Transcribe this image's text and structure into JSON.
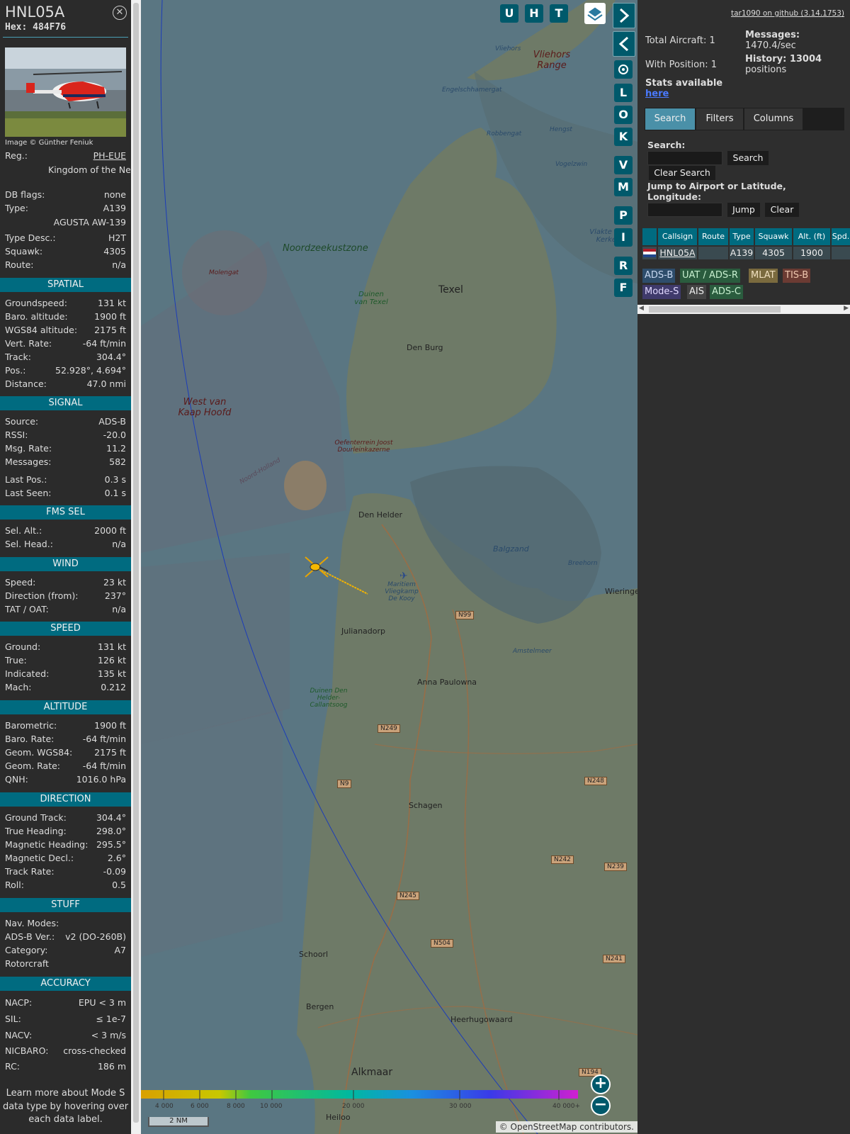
{
  "aircraft": {
    "callsign": "HNL05A",
    "hex": "Hex: 484F76",
    "image_credit": "Image © Günther Feniuk",
    "basic": [
      {
        "label": "Reg.:",
        "value": "PH-EUE"
      },
      {
        "label": "",
        "value": "Kingdom of the Netherlands"
      },
      {
        "label": "DB flags:",
        "value": "none"
      },
      {
        "label": "Type:",
        "value": "A139"
      },
      {
        "label": "",
        "value": "AGUSTA AW-139"
      },
      {
        "label": "Type Desc.:",
        "value": "H2T"
      },
      {
        "label": "Squawk:",
        "value": "4305"
      },
      {
        "label": "Route:",
        "value": "n/a"
      }
    ],
    "sections": {
      "spatial": {
        "title": "SPATIAL",
        "rows": [
          {
            "label": "Groundspeed:",
            "value": "131 kt"
          },
          {
            "label": "Baro. altitude:",
            "value": "1900 ft"
          },
          {
            "label": "WGS84 altitude:",
            "value": "2175 ft"
          },
          {
            "label": "Vert. Rate:",
            "value": "-64 ft/min"
          },
          {
            "label": "Track:",
            "value": "304.4°"
          },
          {
            "label": "Pos.:",
            "value": "52.928°, 4.694°"
          },
          {
            "label": "Distance:",
            "value": "47.0 nmi"
          }
        ]
      },
      "signal": {
        "title": "SIGNAL",
        "rows": [
          {
            "label": "Source:",
            "value": "ADS-B"
          },
          {
            "label": "RSSI:",
            "value": "-20.0"
          },
          {
            "label": "Msg. Rate:",
            "value": "11.2"
          },
          {
            "label": "Messages:",
            "value": "582"
          },
          {
            "label": "Last Pos.:",
            "value": "0.3 s"
          },
          {
            "label": "Last Seen:",
            "value": "0.1 s"
          }
        ]
      },
      "fms": {
        "title": "FMS SEL",
        "rows": [
          {
            "label": "Sel. Alt.:",
            "value": "2000 ft"
          },
          {
            "label": "Sel. Head.:",
            "value": "n/a"
          }
        ]
      },
      "wind": {
        "title": "WIND",
        "rows": [
          {
            "label": "Speed:",
            "value": "23 kt"
          },
          {
            "label": "Direction (from):",
            "value": "237°"
          },
          {
            "label": "TAT / OAT:",
            "value": "n/a"
          }
        ]
      },
      "speed": {
        "title": "SPEED",
        "rows": [
          {
            "label": "Ground:",
            "value": "131 kt"
          },
          {
            "label": "True:",
            "value": "126 kt"
          },
          {
            "label": "Indicated:",
            "value": "135 kt"
          },
          {
            "label": "Mach:",
            "value": "0.212"
          }
        ]
      },
      "altitude": {
        "title": "ALTITUDE",
        "rows": [
          {
            "label": "Barometric:",
            "value": "1900 ft"
          },
          {
            "label": "Baro. Rate:",
            "value": "-64 ft/min"
          },
          {
            "label": "Geom. WGS84:",
            "value": "2175 ft"
          },
          {
            "label": "Geom. Rate:",
            "value": "-64 ft/min"
          },
          {
            "label": "QNH:",
            "value": "1016.0 hPa"
          }
        ]
      },
      "direction": {
        "title": "DIRECTION",
        "rows": [
          {
            "label": "Ground Track:",
            "value": "304.4°"
          },
          {
            "label": "True Heading:",
            "value": "298.0°"
          },
          {
            "label": "Magnetic Heading:",
            "value": "295.5°"
          },
          {
            "label": "Magnetic Decl.:",
            "value": "2.6°"
          },
          {
            "label": "Track Rate:",
            "value": "-0.09"
          },
          {
            "label": "Roll:",
            "value": "0.5"
          }
        ]
      },
      "stuff": {
        "title": "STUFF",
        "rows": [
          {
            "label": "Nav. Modes:",
            "value": ""
          },
          {
            "label": "ADS-B Ver.:",
            "value": "v2 (DO-260B)"
          },
          {
            "label": "Category:",
            "value": "A7"
          },
          {
            "label": "Rotorcraft",
            "value": ""
          }
        ]
      },
      "accuracy": {
        "title": "ACCURACY",
        "rows": [
          {
            "label": "NACP:",
            "value": "EPU < 3 m"
          },
          {
            "label": "SIL:",
            "value": "≤ 1e-7"
          },
          {
            "label": "NACV:",
            "value": "< 3 m/s"
          },
          {
            "label": "NICBARO:",
            "value": "cross-checked"
          },
          {
            "label": "RC:",
            "value": "186 m"
          }
        ]
      }
    },
    "learn_more": "Learn more about Mode S data type by hovering over each data label."
  },
  "map": {
    "buttons": [
      "U",
      "H",
      "T",
      "L",
      "O",
      "K",
      "V",
      "M",
      "P",
      "I",
      "R",
      "F"
    ],
    "labels": {
      "noordzeekustzone": "Noordzeekustzone",
      "texel": "Texel",
      "den_burg": "Den Burg",
      "duinen_texel": "Duinen van Texel",
      "vliehors": "Vliehors Range",
      "vliehors_small": "Vliehors",
      "engelschhamergat": "Engelschhamergat",
      "robbengat": "Robbengat",
      "hengst": "Hengst",
      "vogelzwin": "Vogelzwin",
      "vlakte": "Vlakte Van Kerken",
      "molengat": "Molengat",
      "west_kaap": "West van Kaap Hoofd",
      "oefenterrein": "Oefenterrein Joost Dourleinkazerne",
      "noord_holland": "Noord-Holland",
      "den_helder": "Den Helder",
      "balgzand": "Balgzand",
      "breehorn": "Breehorn",
      "wieringen": "Wieringe",
      "maritiem": "Maritiem Vliegkamp De Kooy",
      "julianadorp": "Julianadorp",
      "amstelmeer": "Amstelmeer",
      "anna_paulowna": "Anna Paulowna",
      "duinen_callantsoog": "Duinen Den Helder-Callantsoog",
      "schagen": "Schagen",
      "schoorl": "Schoorl",
      "bergen": "Bergen",
      "heerhugowaard": "Heerhugowaard",
      "alkmaar": "Alkmaar",
      "heiloo": "Heiloo"
    },
    "roads": [
      "N99",
      "N249",
      "N9",
      "N248",
      "N242",
      "N239",
      "N245",
      "N504",
      "N241",
      "N194"
    ],
    "scale_labels": [
      "4 000",
      "6 000",
      "8 000",
      "10 000",
      "20 000",
      "30 000",
      "40 000+"
    ],
    "scale_nm": "2 NM",
    "attribution": "© OpenStreetMap contributors."
  },
  "right": {
    "github": "tar1090 on github (3.14.1753)",
    "total_aircraft": "Total Aircraft: 1",
    "with_position": "With Position: 1",
    "stats_available": "Stats available",
    "stats_link": "here",
    "messages_label": "Messages:",
    "messages_value": "1470.4/sec",
    "history_label": "History: 13004",
    "history_value": "positions",
    "tabs": [
      "Search",
      "Filters",
      "Columns"
    ],
    "search_label": "Search:",
    "search_btn": "Search",
    "clear_search_btn": "Clear Search",
    "jump_label": "Jump to Airport or Latitude, Longitude:",
    "jump_btn": "Jump",
    "clear_btn": "Clear",
    "table_headers": [
      "Callsign",
      "Route",
      "Type",
      "Squawk",
      "Alt. (ft)",
      "Spd."
    ],
    "table_row": {
      "callsign": "HNL05A",
      "route": "",
      "type": "A139",
      "squawk": "4305",
      "alt": "1900",
      "spd": ""
    },
    "source_chips": [
      {
        "label": "ADS-B",
        "bg": "#2e4d6b"
      },
      {
        "label": "UAT / ADS-R",
        "bg": "#2a5c3e"
      },
      {
        "label": "MLAT",
        "bg": "#7a6a3e"
      },
      {
        "label": "TIS-B",
        "bg": "#6b3b33"
      },
      {
        "label": "Mode-S",
        "bg": "#3f3a6b"
      },
      {
        "label": "AIS",
        "bg": "#444444"
      },
      {
        "label": "ADS-C",
        "bg": "#2a5c3e"
      }
    ]
  }
}
